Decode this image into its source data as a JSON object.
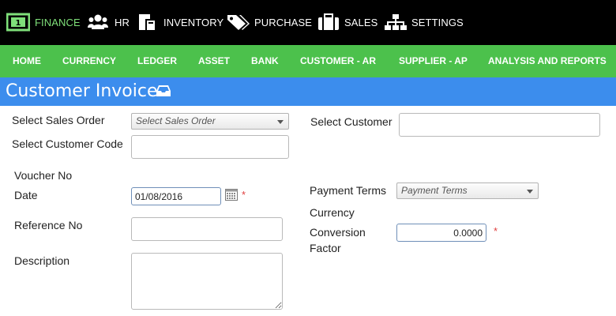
{
  "top_modules": [
    {
      "label": "FINANCE",
      "icon": "finance-icon"
    },
    {
      "label": "HR",
      "icon": "people-icon"
    },
    {
      "label": "INVENTORY",
      "icon": "inventory-icon"
    },
    {
      "label": "PURCHASE",
      "icon": "tags-icon"
    },
    {
      "label": "SALES",
      "icon": "briefcase-icon"
    },
    {
      "label": "SETTINGS",
      "icon": "sitemap-icon"
    }
  ],
  "nav": [
    "HOME",
    "CURRENCY",
    "LEDGER",
    "ASSET",
    "BANK",
    "CUSTOMER - AR",
    "SUPPLIER - AP",
    "ANALYSIS AND REPORTS"
  ],
  "page": {
    "title": "Customer Invoice",
    "title_icon": "inbox-icon"
  },
  "form": {
    "sales_order_label": "Select Sales Order",
    "sales_order_value": "Select Sales Order",
    "customer_code_label": "Select Customer Code",
    "customer_code_value": "",
    "customer_label": "Select Customer",
    "customer_value": "",
    "voucher_label": "Voucher No",
    "date_label": "Date",
    "date_value": "01/08/2016",
    "payment_terms_label": "Payment Terms",
    "payment_terms_value": "Payment Terms",
    "currency_label": "Currency",
    "reference_label": "Reference No",
    "reference_value": "",
    "conversion_label_line1": "Conversion",
    "conversion_label_line2": "Factor",
    "conversion_value": "0.0000",
    "description_label": "Description",
    "description_value": "",
    "required_mark": "*"
  },
  "colors": {
    "topbar": "#000000",
    "nav": "#4cc14c",
    "titlebar": "#3c8ded",
    "required": "#e04040"
  }
}
